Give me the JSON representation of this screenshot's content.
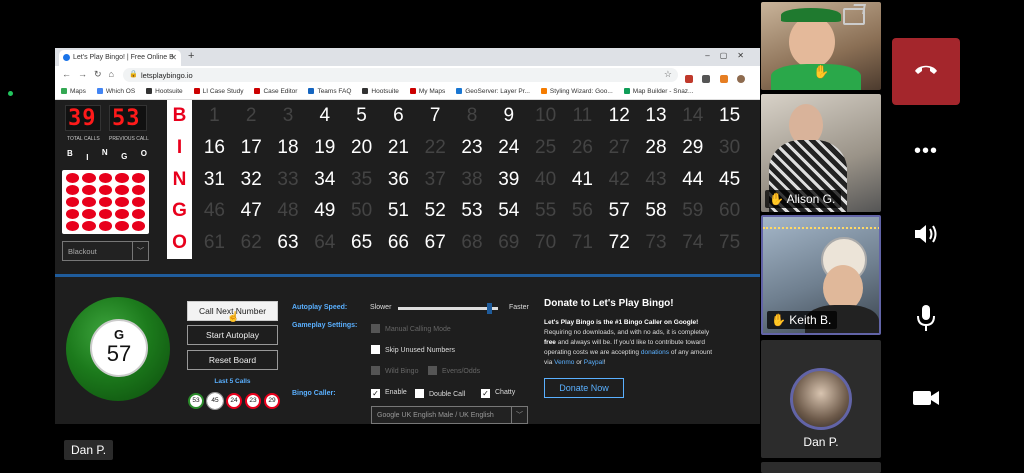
{
  "browser": {
    "tab_title": "Let's Play Bingo! | Free Online B",
    "url": "letsplaybingo.io",
    "bookmarks": [
      "Maps",
      "Which OS",
      "Hootsuite",
      "LI Case Study",
      "Case Editor",
      "Teams FAQ",
      "Hootsuite",
      "My Maps",
      "GeoServer: Layer Pr...",
      "Styling Wizard: Goo...",
      "Map Builder - Snaz..."
    ]
  },
  "counters": {
    "total_calls": "39",
    "previous_call": "53",
    "total_label": "TOTAL CALLS",
    "previous_label": "PREVIOUS CALL"
  },
  "mini_bingo": [
    "B",
    "I",
    "N",
    "G",
    "O"
  ],
  "pattern_select": {
    "value": "Blackout"
  },
  "board": {
    "letters": [
      "B",
      "I",
      "N",
      "G",
      "O"
    ],
    "called": [
      4,
      5,
      6,
      7,
      9,
      12,
      13,
      15,
      16,
      17,
      18,
      19,
      20,
      21,
      23,
      24,
      28,
      29,
      31,
      32,
      34,
      36,
      39,
      41,
      44,
      45,
      47,
      49,
      51,
      52,
      53,
      54,
      57,
      58,
      63,
      65,
      66,
      67,
      72
    ]
  },
  "current_ball": {
    "letter": "G",
    "number": "57"
  },
  "controls": {
    "call_next": "Call Next Number",
    "start_autoplay": "Start Autoplay",
    "reset_board": "Reset Board",
    "last5_label": "Last 5 Calls",
    "last5": [
      "53",
      "45",
      "24",
      "23",
      "29"
    ]
  },
  "settings": {
    "autoplay_speed_label": "Autoplay Speed:",
    "slower": "Slower",
    "faster": "Faster",
    "speed_level": 0.94,
    "gameplay_label": "Gameplay Settings:",
    "manual_calling": "Manual Calling Mode",
    "skip_unused": "Skip Unused Numbers",
    "wild_bingo": "Wild Bingo",
    "evens_odds": "Evens/Odds",
    "caller_label": "Bingo Caller:",
    "enable": "Enable",
    "double_call": "Double Call",
    "chatty": "Chatty",
    "voice": "Google UK English Male / UK English"
  },
  "donate": {
    "title": "Donate to Let's Play Bingo!",
    "p1_bold": "Let's Play Bingo is the #1 Bingo Caller on Google!",
    "p2": "Requiring no downloads, and with no ads, it is completely",
    "p3_a": "free",
    "p3_b": "and always will be. If you'd like to contribute toward",
    "p4": "operating costs we are accepting",
    "p4_link": "donations",
    "p4_end": "of any amount",
    "p5_via": "via",
    "venmo": "Venmo",
    "or": "or",
    "paypal": "Paypal",
    "button": "Donate Now"
  },
  "participants": [
    {
      "name": ""
    },
    {
      "name": "Alison G."
    },
    {
      "name": "Keith B."
    },
    {
      "name": "Dan P."
    }
  ],
  "presenter_name": "Dan P.",
  "colors": {
    "hangup": "#a4262c",
    "accent": "#6264a7",
    "bingo_red": "#e8001c",
    "link_blue": "#5ab0ff"
  }
}
